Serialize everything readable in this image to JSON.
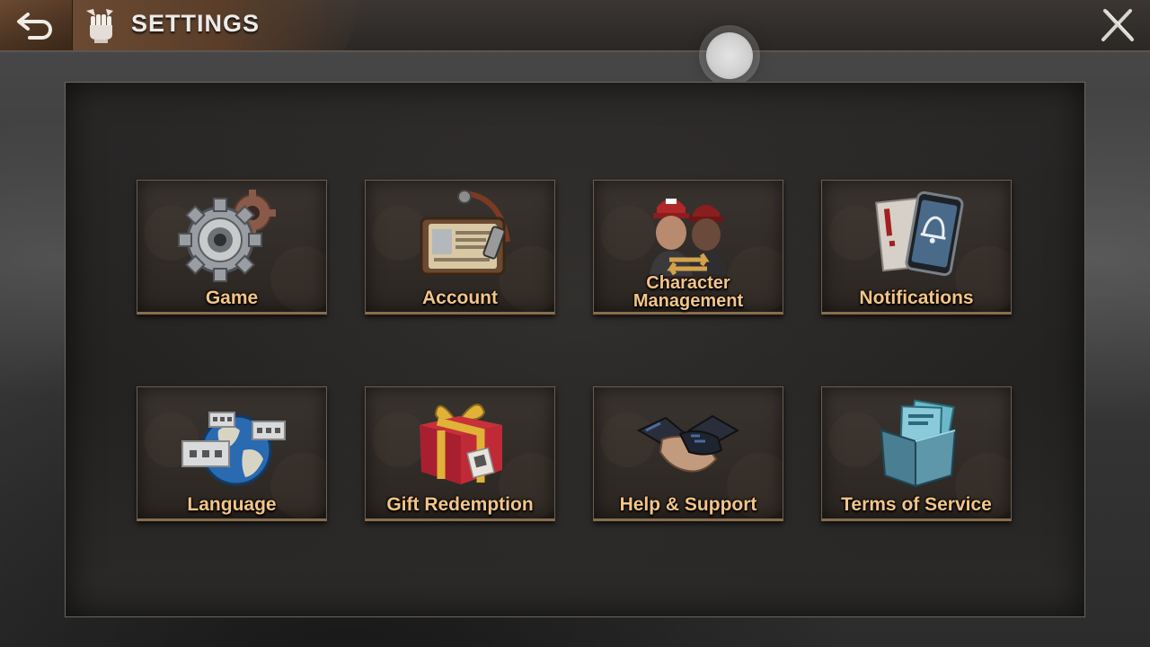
{
  "header": {
    "title": "SETTINGS",
    "back_icon": "back-arrow-icon",
    "emblem_icon": "raised-fist-icon",
    "close_icon": "close-x-icon"
  },
  "tiles": [
    {
      "label": "Game",
      "icon": "gear-icon"
    },
    {
      "label": "Account",
      "icon": "id-card-icon"
    },
    {
      "label": "Character Management",
      "line1": "Character",
      "line2": "Management",
      "icon": "characters-icon"
    },
    {
      "label": "Notifications",
      "icon": "phone-bell-icon"
    },
    {
      "label": "Language",
      "icon": "globe-chat-icon"
    },
    {
      "label": "Gift Redemption",
      "icon": "gift-box-icon"
    },
    {
      "label": "Help & Support",
      "icon": "handshake-icon"
    },
    {
      "label": "Terms of Service",
      "icon": "documents-folder-icon"
    }
  ],
  "colors": {
    "label": "#f2c58a",
    "tile_border": "#8a6d4c",
    "header_plate": "#6b4a32"
  }
}
